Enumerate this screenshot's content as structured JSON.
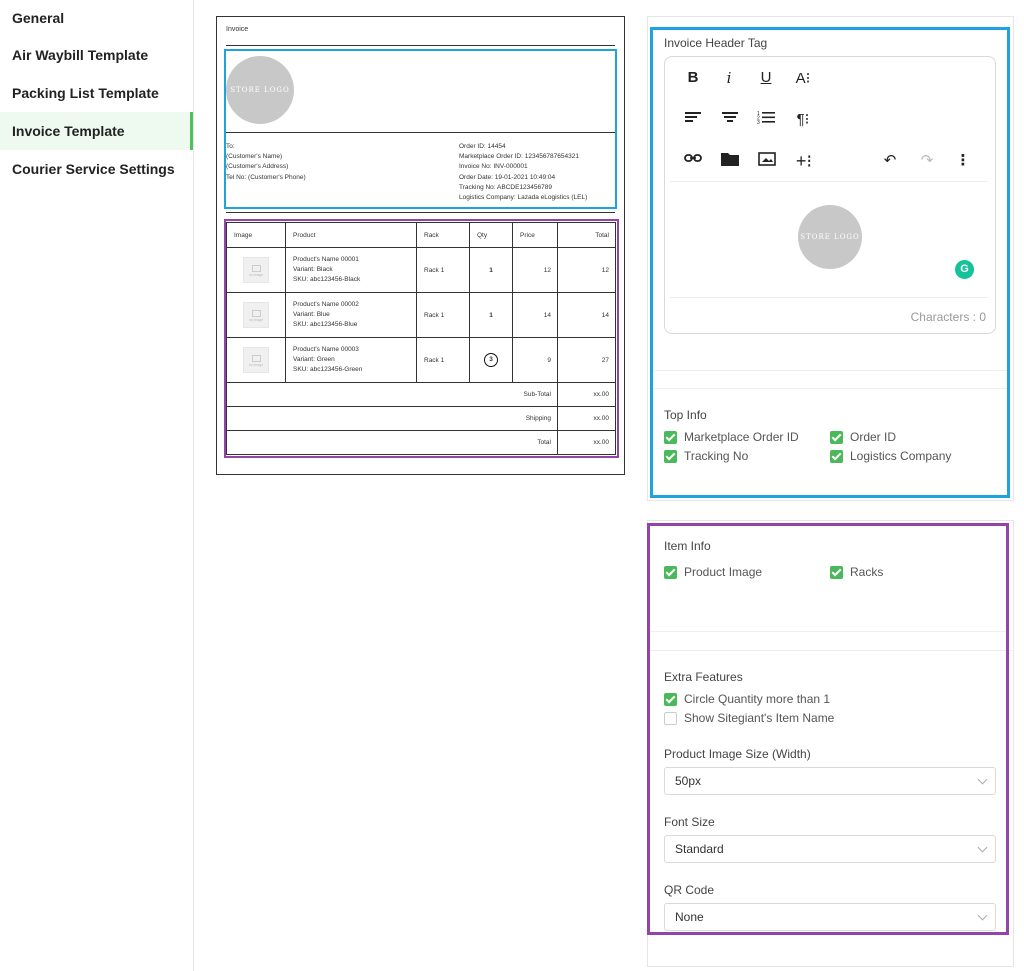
{
  "sidebar": {
    "items": [
      {
        "label": "General"
      },
      {
        "label": "Air Waybill Template"
      },
      {
        "label": "Packing List Template"
      },
      {
        "label": "Invoice Template"
      },
      {
        "label": "Courier Service Settings"
      }
    ],
    "active_index": 3
  },
  "preview": {
    "title": "Invoice",
    "logo_text": "STORE LOGO",
    "to": [
      "To:",
      "(Customer's Name)",
      "(Customer's Address)",
      "Tel No: (Customer's Phone)"
    ],
    "order_info": [
      "Order ID: 14454",
      "Marketplace Order ID: 123456787654321",
      "Invoice No: INV-000001",
      "Order Date: 19-01-2021 10:49:04",
      "Tracking No: ABCDE123456789",
      "Logistics Company: Lazada eLogistics (LEL)"
    ],
    "table": {
      "headers": [
        "Image",
        "Product",
        "Rack",
        "Qty",
        "Price",
        "Total"
      ],
      "no_image_label": "no image",
      "rows": [
        {
          "lines": [
            "Product's Name 00001",
            "Variant: Black",
            "SKU: abc123456-Black"
          ],
          "rack": "Rack 1",
          "qty": "1",
          "price": "12",
          "total": "12"
        },
        {
          "lines": [
            "Product's Name 00002",
            "Variant: Blue",
            "SKU: abc123456-Blue"
          ],
          "rack": "Rack 1",
          "qty": "1",
          "price": "14",
          "total": "14"
        },
        {
          "lines": [
            "Product's Name 00003",
            "Variant: Green",
            "SKU: abc123456-Green"
          ],
          "rack": "Rack 1",
          "qty": "3",
          "price": "9",
          "total": "27"
        }
      ],
      "summary": [
        {
          "label": "Sub-Total",
          "value": "xx.00"
        },
        {
          "label": "Shipping",
          "value": "xx.00"
        },
        {
          "label": "Total",
          "value": "xx.00"
        }
      ]
    }
  },
  "header_tag": {
    "title": "Invoice Header Tag",
    "logo_text": "STORE LOGO",
    "characters_label": "Characters : 0",
    "toolbar_icons": [
      "bold-icon",
      "italic-icon",
      "underline-icon",
      "font-size-icon",
      "align-left-icon",
      "align-center-icon",
      "ordered-list-icon",
      "paragraph-icon",
      "link-icon",
      "folder-icon",
      "image-icon",
      "insert-icon",
      "undo-icon",
      "redo-icon",
      "more-icon"
    ]
  },
  "top_info": {
    "title": "Top Info",
    "options": [
      {
        "label": "Marketplace Order ID",
        "checked": true
      },
      {
        "label": "Order ID",
        "checked": true
      },
      {
        "label": "Tracking No",
        "checked": true
      },
      {
        "label": "Logistics Company",
        "checked": true
      }
    ]
  },
  "item_info": {
    "title": "Item Info",
    "options": [
      {
        "label": "Product Image",
        "checked": true
      },
      {
        "label": "Racks",
        "checked": true
      }
    ]
  },
  "extra_features": {
    "title": "Extra Features",
    "options": [
      {
        "label": "Circle Quantity more than 1",
        "checked": true
      },
      {
        "label": "Show Sitegiant's Item Name",
        "checked": false
      }
    ],
    "image_size": {
      "label": "Product Image Size (Width)",
      "value": "50px"
    },
    "font_size": {
      "label": "Font Size",
      "value": "Standard"
    },
    "qr_code": {
      "label": "QR Code",
      "value": "None"
    }
  },
  "colors": {
    "accent_green": "#4cb85c",
    "highlight_blue": "#1ea4db",
    "highlight_purple": "#9444a8"
  }
}
